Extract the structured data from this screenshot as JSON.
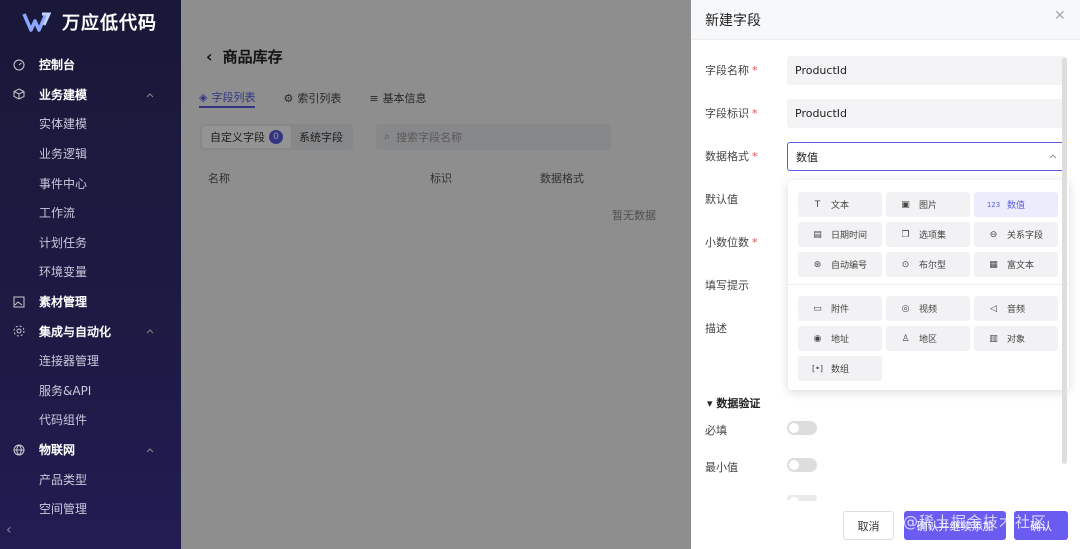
{
  "app": {
    "logo_text": "万应低代码"
  },
  "sidebar": {
    "items": [
      {
        "label": "控制台",
        "type": "group",
        "icon": "dashboard-icon"
      },
      {
        "label": "业务建模",
        "type": "group",
        "icon": "cube-icon",
        "expanded": true
      },
      {
        "label": "实体建模",
        "type": "sub"
      },
      {
        "label": "业务逻辑",
        "type": "sub"
      },
      {
        "label": "事件中心",
        "type": "sub"
      },
      {
        "label": "工作流",
        "type": "sub"
      },
      {
        "label": "计划任务",
        "type": "sub"
      },
      {
        "label": "环境变量",
        "type": "sub"
      },
      {
        "label": "素材管理",
        "type": "group",
        "icon": "image-icon"
      },
      {
        "label": "集成与自动化",
        "type": "group",
        "icon": "integration-icon",
        "expanded": true
      },
      {
        "label": "连接器管理",
        "type": "sub"
      },
      {
        "label": "服务&API",
        "type": "sub"
      },
      {
        "label": "代码组件",
        "type": "sub"
      },
      {
        "label": "物联网",
        "type": "group",
        "icon": "globe-icon",
        "expanded": true
      },
      {
        "label": "产品类型",
        "type": "sub"
      },
      {
        "label": "空间管理",
        "type": "sub"
      }
    ]
  },
  "main": {
    "title": "商品库存",
    "tabs": [
      {
        "label": "字段列表",
        "active": true
      },
      {
        "label": "索引列表"
      },
      {
        "label": "基本信息"
      }
    ],
    "segment": {
      "custom_label": "自定义字段",
      "custom_count": "0",
      "system_label": "系统字段"
    },
    "search_placeholder": "搜索字段名称",
    "columns": [
      "名称",
      "标识",
      "数据格式"
    ],
    "empty_text": "暂无数据"
  },
  "drawer": {
    "title": "新建字段",
    "fields": {
      "name_label": "字段名称",
      "name_value": "ProductId",
      "key_label": "字段标识",
      "key_value": "ProductId",
      "format_label": "数据格式",
      "format_value": "数值",
      "default_label": "默认值",
      "decimal_label": "小数位数",
      "hint_label": "填写提示",
      "desc_label": "描述"
    },
    "format_options_group1": [
      {
        "label": "文本",
        "icon": "text-icon"
      },
      {
        "label": "图片",
        "icon": "image-icon"
      },
      {
        "label": "数值",
        "icon": "number-icon",
        "active": true
      },
      {
        "label": "日期时间",
        "icon": "calendar-icon"
      },
      {
        "label": "选项集",
        "icon": "options-icon"
      },
      {
        "label": "关系字段",
        "icon": "relation-icon"
      },
      {
        "label": "自动编号",
        "icon": "auto-number-icon"
      },
      {
        "label": "布尔型",
        "icon": "toggle-icon"
      },
      {
        "label": "富文本",
        "icon": "richtext-icon"
      }
    ],
    "format_options_group2": [
      {
        "label": "附件",
        "icon": "folder-icon"
      },
      {
        "label": "视频",
        "icon": "video-icon"
      },
      {
        "label": "音频",
        "icon": "audio-icon"
      },
      {
        "label": "地址",
        "icon": "location-icon"
      },
      {
        "label": "地区",
        "icon": "region-icon"
      },
      {
        "label": "对象",
        "icon": "object-icon"
      },
      {
        "label": "数组",
        "icon": "array-icon"
      }
    ],
    "validation": {
      "title": "数据验证",
      "required_label": "必填",
      "min_label": "最小值"
    },
    "footer": {
      "cancel": "取消",
      "confirm_continue": "确认并继续添加",
      "confirm": "确认"
    }
  },
  "watermark": "@稀土掘金技术社区",
  "colors": {
    "accent": "#5b5ce0",
    "sidebar_bg": "#1d1a44",
    "required": "#e34d59"
  }
}
